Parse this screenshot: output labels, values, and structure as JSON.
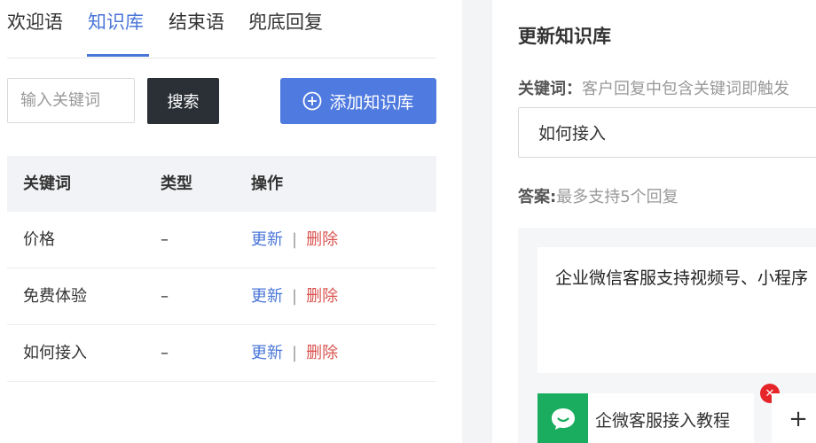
{
  "tabs": [
    {
      "label": "欢迎语",
      "active": false
    },
    {
      "label": "知识库",
      "active": true
    },
    {
      "label": "结束语",
      "active": false
    },
    {
      "label": "兜底回复",
      "active": false
    }
  ],
  "search": {
    "placeholder": "输入关键词",
    "button_label": "搜索"
  },
  "add_button": {
    "label": "添加知识库",
    "icon": "plus-circle-icon"
  },
  "table": {
    "headers": [
      "关键词",
      "类型",
      "操作"
    ],
    "rows": [
      {
        "keyword": "价格",
        "type": "–",
        "update": "更新",
        "separator": "|",
        "delete": "删除"
      },
      {
        "keyword": "免费体验",
        "type": "–",
        "update": "更新",
        "separator": "|",
        "delete": "删除"
      },
      {
        "keyword": "如何接入",
        "type": "–",
        "update": "更新",
        "separator": "|",
        "delete": "删除"
      }
    ]
  },
  "dialog": {
    "title": "更新知识库",
    "keyword_label": "关键词：",
    "keyword_hint": "客户回复中包含关键词即触发",
    "keyword_value": "如何接入",
    "answer_label": "答案:",
    "answer_hint": "最多支持5个回复",
    "answer_text": "企业微信客服支持视频号、小程序",
    "attachment_label": "企微客服接入教程",
    "remove_symbol": "✕",
    "add_symbol": "+"
  },
  "colors": {
    "accent": "#4a76d8",
    "primary_button": "#4f7ae0",
    "dark_button": "#2b3036",
    "delete": "#d9534f",
    "wechat_green": "#1aad5f",
    "badge_red": "#e5252a"
  }
}
